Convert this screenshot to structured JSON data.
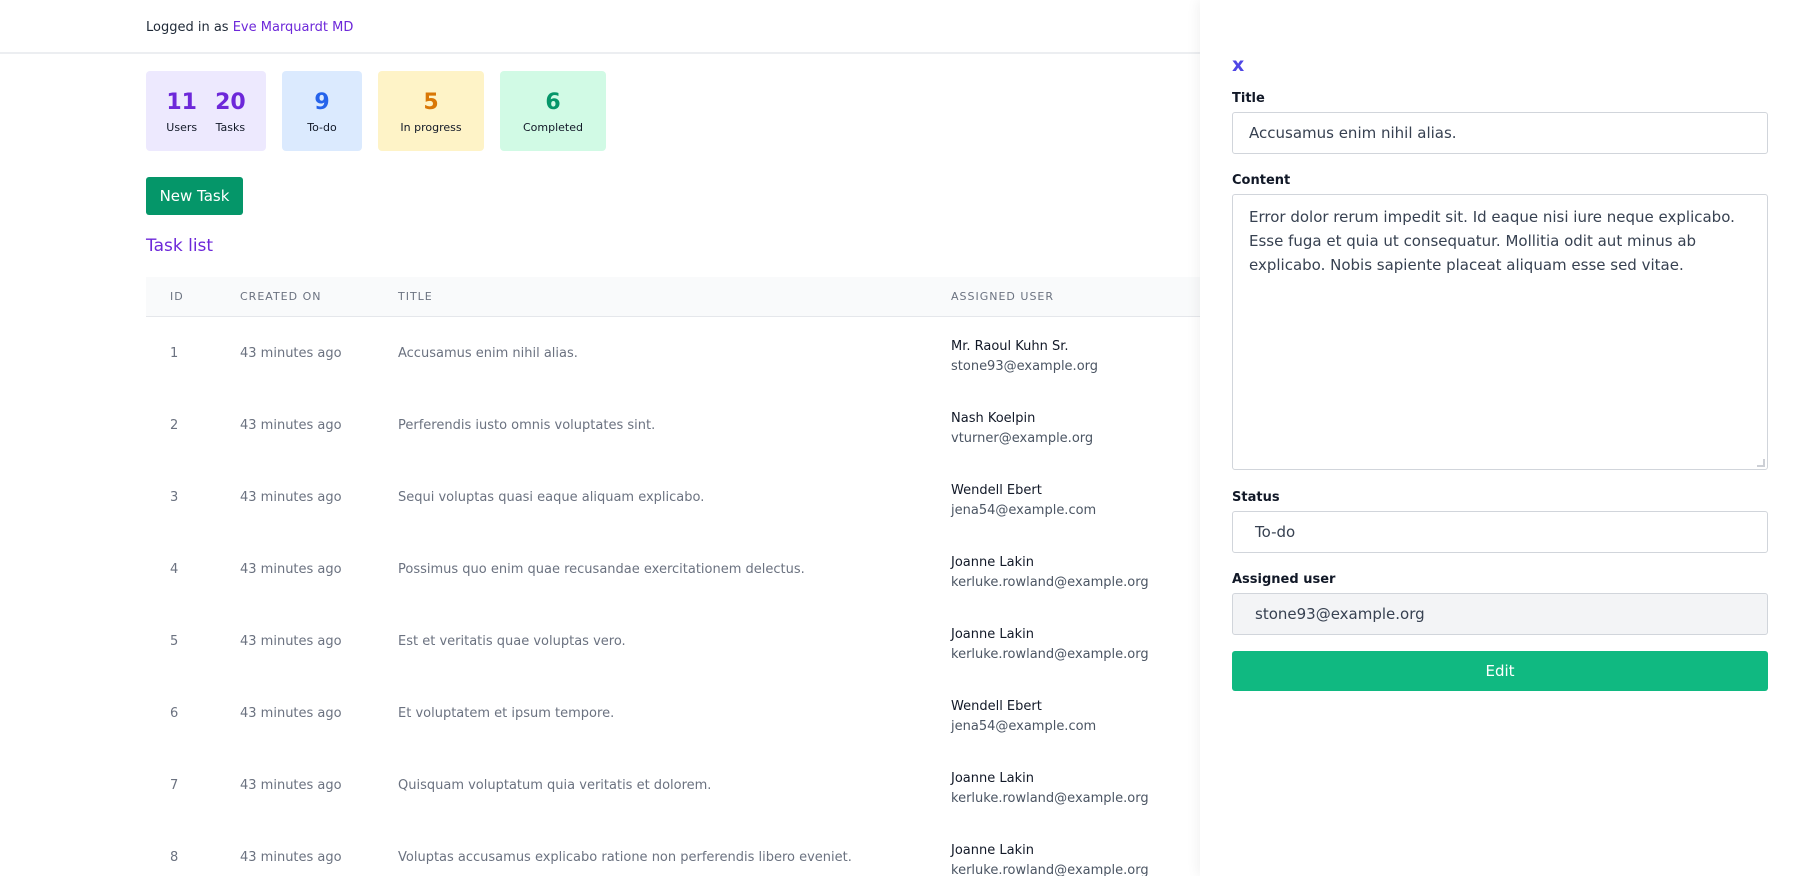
{
  "header": {
    "logged_in_prefix": "Logged in as",
    "user_name": "Eve Marquardt MD"
  },
  "stats": {
    "users": {
      "value": "11",
      "label": "Users"
    },
    "tasks": {
      "value": "20",
      "label": "Tasks"
    },
    "todo": {
      "value": "9",
      "label": "To-do"
    },
    "in_progress": {
      "value": "5",
      "label": "In progress"
    },
    "completed": {
      "value": "6",
      "label": "Completed"
    }
  },
  "new_task_label": "New Task",
  "task_list_title": "Task list",
  "table": {
    "columns": [
      "ID",
      "CREATED ON",
      "TITLE",
      "ASSIGNED USER"
    ],
    "rows": [
      {
        "id": "1",
        "created": "43 minutes ago",
        "title": "Accusamus enim nihil alias.",
        "user": "Mr. Raoul Kuhn Sr.",
        "email": "stone93@example.org"
      },
      {
        "id": "2",
        "created": "43 minutes ago",
        "title": "Perferendis iusto omnis voluptates sint.",
        "user": "Nash Koelpin",
        "email": "vturner@example.org"
      },
      {
        "id": "3",
        "created": "43 minutes ago",
        "title": "Sequi voluptas quasi eaque aliquam explicabo.",
        "user": "Wendell Ebert",
        "email": "jena54@example.com"
      },
      {
        "id": "4",
        "created": "43 minutes ago",
        "title": "Possimus quo enim quae recusandae exercitationem delectus.",
        "user": "Joanne Lakin",
        "email": "kerluke.rowland@example.org"
      },
      {
        "id": "5",
        "created": "43 minutes ago",
        "title": "Est et veritatis quae voluptas vero.",
        "user": "Joanne Lakin",
        "email": "kerluke.rowland@example.org"
      },
      {
        "id": "6",
        "created": "43 minutes ago",
        "title": "Et voluptatem et ipsum tempore.",
        "user": "Wendell Ebert",
        "email": "jena54@example.com"
      },
      {
        "id": "7",
        "created": "43 minutes ago",
        "title": "Quisquam voluptatum quia veritatis et dolorem.",
        "user": "Joanne Lakin",
        "email": "kerluke.rowland@example.org"
      },
      {
        "id": "8",
        "created": "43 minutes ago",
        "title": "Voluptas accusamus explicabo ratione non perferendis libero eveniet.",
        "user": "Joanne Lakin",
        "email": "kerluke.rowland@example.org"
      }
    ]
  },
  "panel": {
    "close_label": "x",
    "title_label": "Title",
    "title_value": "Accusamus enim nihil alias.",
    "content_label": "Content",
    "content_value": "Error dolor rerum impedit sit. Id eaque nisi iure neque explicabo. Esse fuga et quia ut consequatur. Mollitia odit aut minus ab explicabo. Nobis sapiente placeat aliquam esse sed vitae.",
    "status_label": "Status",
    "status_value": "To-do",
    "assigned_label": "Assigned user",
    "assigned_value": "stone93@example.org",
    "edit_label": "Edit"
  }
}
